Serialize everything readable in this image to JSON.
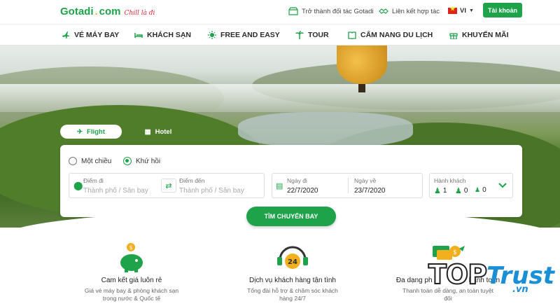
{
  "header": {
    "logo_brand": "Gotadi",
    "logo_dot": ".",
    "logo_suffix": "com",
    "logo_tagline": "Chill là đi",
    "partner_link": "Trở thành đối tác Gotadi",
    "contact_link": "Liên kết hợp tác",
    "language": "VI",
    "account_button": "Tài khoản"
  },
  "nav": {
    "items": [
      {
        "label": "VÉ MÁY BAY",
        "icon": "plane-icon"
      },
      {
        "label": "KHÁCH SẠN",
        "icon": "bed-icon"
      },
      {
        "label": "FREE AND EASY",
        "icon": "sun-icon"
      },
      {
        "label": "TOUR",
        "icon": "palm-icon"
      },
      {
        "label": "CẨM NANG DU LỊCH",
        "icon": "book-icon"
      },
      {
        "label": "KHUYẾN MÃI",
        "icon": "gift-icon"
      }
    ]
  },
  "search": {
    "tabs": [
      {
        "label": "Flight",
        "active": true
      },
      {
        "label": "Hotel",
        "active": false
      }
    ],
    "trip_options": [
      {
        "label": "Một chiều",
        "selected": false
      },
      {
        "label": "Khứ hồi",
        "selected": true
      }
    ],
    "origin": {
      "label": "Điểm đi",
      "placeholder": "Thành phố / Sân bay"
    },
    "destination": {
      "label": "Điểm đến",
      "placeholder": "Thành phố / Sân bay"
    },
    "depart": {
      "label": "Ngày đi",
      "value": "22/7/2020"
    },
    "return": {
      "label": "Ngày về",
      "value": "23/7/2020"
    },
    "passengers": {
      "label": "Hành khách",
      "adults": "1",
      "children": "0",
      "infants": "0"
    },
    "submit_label": "TÌM CHUYẾN BAY"
  },
  "features": [
    {
      "title": "Cam kết giá luôn rẻ",
      "desc_line1": "Giá vé máy bay & phòng khách sạn",
      "desc_line2": "trong nước & Quốc tế"
    },
    {
      "title": "Dịch vụ khách hàng tận tình",
      "desc_line1": "Tổng đài hỗ trợ & chăm sóc khách",
      "desc_line2": "hàng 24/7",
      "badge": "24"
    },
    {
      "title": "Đa dạng ph",
      "title_tail": "hanh toán",
      "desc_line1": "Thanh toán dễ dàng, an toàn tuyệt",
      "desc_line2": "đối"
    }
  ],
  "watermark": {
    "top": "TOP",
    "trust": "Trust",
    "domain": ".vn"
  },
  "colors": {
    "primary": "#1ea34a",
    "accent": "#f2b01e",
    "watermark_blue": "#1a8fd6"
  }
}
